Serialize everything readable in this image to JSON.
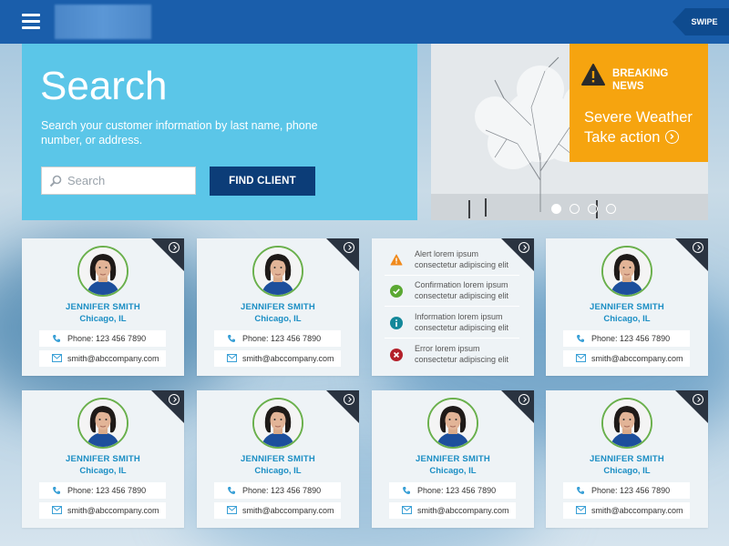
{
  "header": {
    "menu_icon": "hamburger-icon",
    "swipe_label": "SWIPE"
  },
  "search": {
    "title": "Search",
    "description": "Search your customer information by last name, phone number, or address.",
    "placeholder": "Search",
    "value": "",
    "button_label": "FIND CLIENT"
  },
  "news": {
    "label": "BREAKING NEWS",
    "headline": "Severe Weather",
    "action": "Take action",
    "slides": 4,
    "active_slide": 1,
    "accent": "#f6a40f"
  },
  "clients": [
    {
      "name": "JENNIFER SMITH",
      "city": "Chicago, IL",
      "phone": "Phone: 123 456 7890",
      "email": "smith@abccompany.com"
    },
    {
      "name": "JENNIFER SMITH",
      "city": "Chicago, IL",
      "phone": "Phone: 123 456 7890",
      "email": "smith@abccompany.com"
    },
    {
      "name": "JENNIFER SMITH",
      "city": "Chicago, IL",
      "phone": "Phone: 123 456 7890",
      "email": "smith@abccompany.com"
    },
    {
      "name": "JENNIFER SMITH",
      "city": "Chicago, IL",
      "phone": "Phone: 123 456 7890",
      "email": "smith@abccompany.com"
    },
    {
      "name": "JENNIFER SMITH",
      "city": "Chicago, IL",
      "phone": "Phone: 123 456 7890",
      "email": "smith@abccompany.com"
    },
    {
      "name": "JENNIFER SMITH",
      "city": "Chicago, IL",
      "phone": "Phone: 123 456 7890",
      "email": "smith@abccompany.com"
    },
    {
      "name": "JENNIFER SMITH",
      "city": "Chicago, IL",
      "phone": "Phone: 123 456 7890",
      "email": "smith@abccompany.com"
    }
  ],
  "alerts": [
    {
      "type": "alert",
      "icon": "warning-icon",
      "line1": "Alert lorem ipsum",
      "line2": "consectetur adipiscing elit",
      "color": "#f08a1c"
    },
    {
      "type": "confirmation",
      "icon": "check-icon",
      "line1": "Confirmation lorem ipsum",
      "line2": "consectetur adipiscing elit",
      "color": "#5aa832"
    },
    {
      "type": "information",
      "icon": "info-icon",
      "line1": "Information lorem ipsum",
      "line2": "consectetur adipiscing elit",
      "color": "#13889a"
    },
    {
      "type": "error",
      "icon": "error-icon",
      "line1": "Error lorem ipsum",
      "line2": "consectetur adipiscing elit",
      "color": "#b3202a"
    }
  ],
  "colors": {
    "topbar": "#1a5eab",
    "search_panel": "#5bc6e8",
    "primary_button": "#0c3d78",
    "client_text": "#1b8ec4"
  }
}
